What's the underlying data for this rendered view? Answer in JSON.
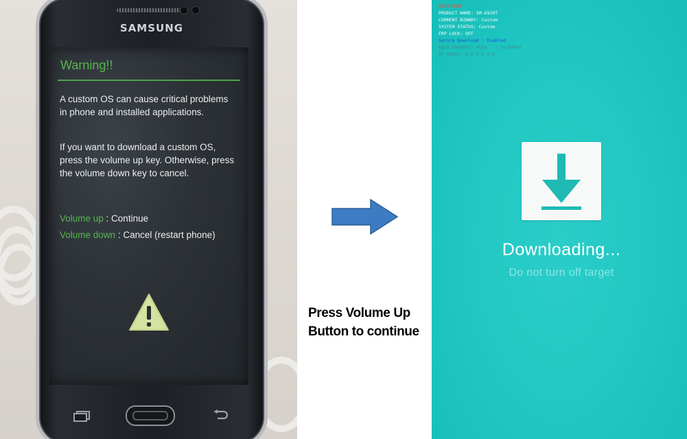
{
  "phone": {
    "brand": "SAMSUNG",
    "warning": {
      "title": "Warning!!",
      "para1": "A custom OS can cause critical problems in phone and installed applications.",
      "para2": "If you want to download a custom OS, press the volume up key. Otherwise, press the volume down key to cancel.",
      "volume_up_key": "Volume up",
      "volume_up_action": " : Continue",
      "volume_down_key": "Volume down",
      "volume_down_action": " : Cancel (restart phone)"
    }
  },
  "caption": {
    "line1": "Press Volume Up",
    "line2": "Button to continue"
  },
  "download_screen": {
    "debug_lines": [
      {
        "text": "ODIN MODE",
        "color": "#ff4a2a"
      },
      {
        "text": "PRODUCT NAME: SM-G920T",
        "color": "#ffffff"
      },
      {
        "text": "CURRENT BINARY: Custom",
        "color": "#ffffff"
      },
      {
        "text": "SYSTEM STATUS: Custom",
        "color": "#ffffff"
      },
      {
        "text": "FRP LOCK: OFF",
        "color": "#ffffff"
      },
      {
        "text": "Secure Download : Enabled",
        "color": "#1a52d6"
      },
      {
        "text": "KNOX WARRANTY VOID : 1 (0x0000)",
        "color": "#3c8f8c"
      },
      {
        "text": "RP SWREV: B:0 K:0 S:0",
        "color": "#3c8f8c"
      }
    ],
    "title": "Downloading...",
    "subtitle": "Do not turn off target"
  },
  "colors": {
    "warning_green": "#56b64e",
    "teal_background": "#1fc6c1",
    "arrow_blue": "#3d7cc2"
  },
  "icons": [
    "warning-triangle-icon",
    "arrow-right-icon",
    "download-arrow-icon",
    "recent-apps-icon",
    "back-icon"
  ]
}
